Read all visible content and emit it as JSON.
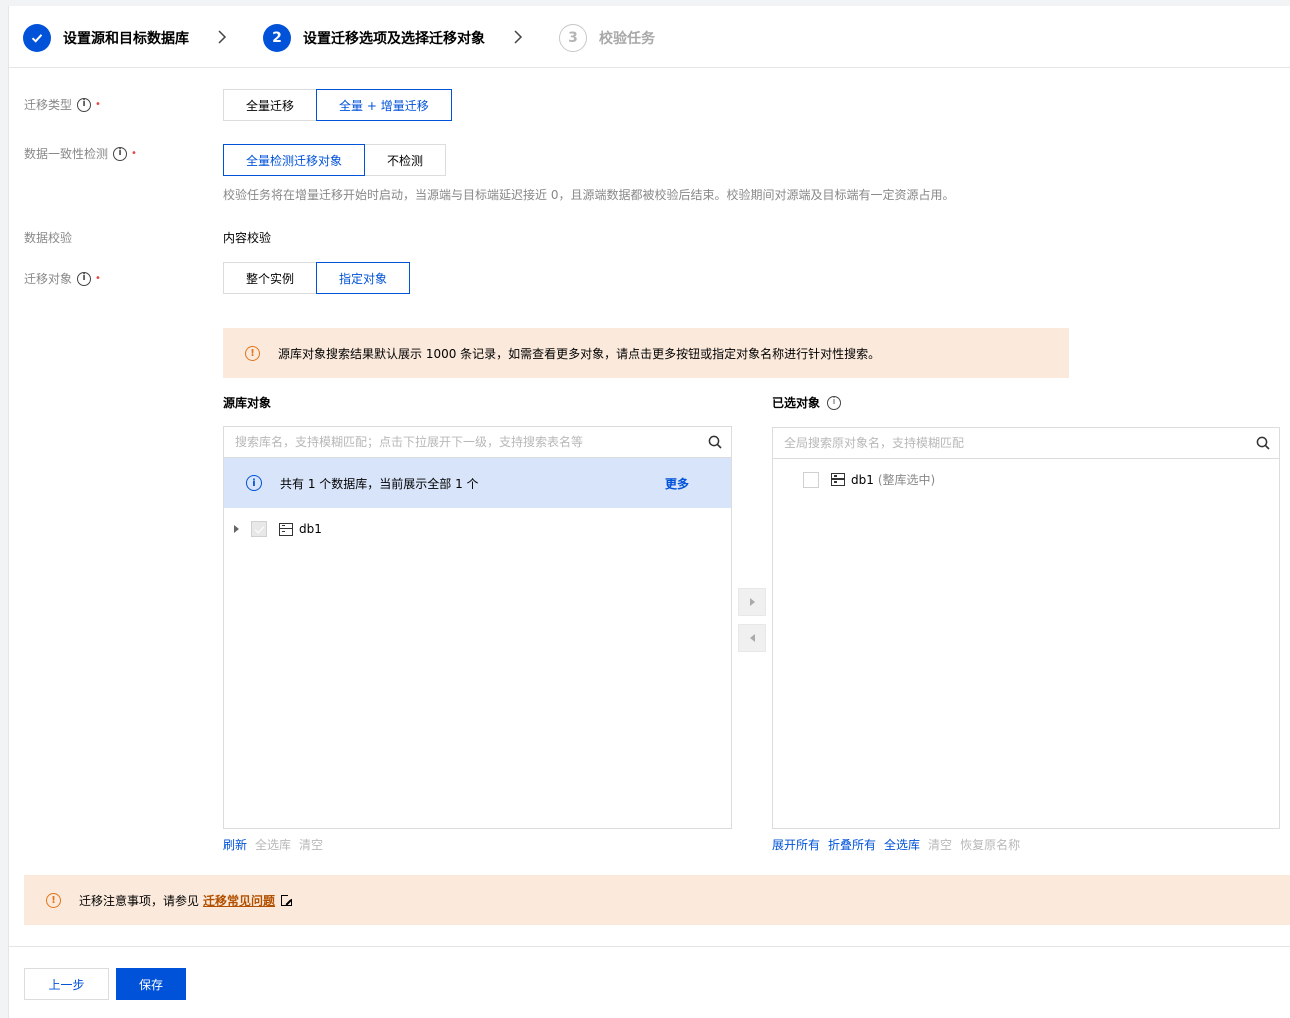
{
  "steps": [
    {
      "number": "",
      "label": "设置源和目标数据库",
      "state": "done"
    },
    {
      "number": "2",
      "label": "设置迁移选项及选择迁移对象",
      "state": "active"
    },
    {
      "number": "3",
      "label": "校验任务",
      "state": "todo"
    }
  ],
  "form": {
    "migration_type": {
      "label": "迁移类型",
      "options": [
        "全量迁移",
        "全量 + 增量迁移"
      ],
      "selected": "全量 + 增量迁移"
    },
    "consistency_check": {
      "label": "数据一致性检测",
      "options": [
        "全量检测迁移对象",
        "不检测"
      ],
      "selected": "全量检测迁移对象",
      "hint": "校验任务将在增量迁移开始时启动，当源端与目标端延迟接近 0，且源端数据都被校验后结束。校验期间对源端及目标端有一定资源占用。"
    },
    "data_verification": {
      "label": "数据校验",
      "value": "内容校验"
    },
    "migration_objects": {
      "label": "迁移对象",
      "options": [
        "整个实例",
        "指定对象"
      ],
      "selected": "指定对象"
    }
  },
  "search_warning": "源库对象搜索结果默认展示 1000 条记录，如需查看更多对象，请点击更多按钮或指定对象名称进行针对性搜索。",
  "source": {
    "title": "源库对象",
    "search_placeholder": "搜索库名，支持模糊匹配；点击下拉展开下一级，支持搜索表名等",
    "info_text": "共有 1 个数据库，当前展示全部 1 个",
    "more_label": "更多",
    "items": [
      {
        "name": "db1"
      }
    ],
    "links": {
      "refresh": "刷新",
      "select_all": "全选库",
      "clear": "清空"
    }
  },
  "selected": {
    "title": "已选对象",
    "search_placeholder": "全局搜索原对象名，支持模糊匹配",
    "items": [
      {
        "name": "db1",
        "note": "(整库选中)"
      }
    ],
    "links": {
      "expand_all": "展开所有",
      "collapse_all": "折叠所有",
      "select_all": "全选库",
      "clear": "清空",
      "restore_names": "恢复原名称"
    }
  },
  "notice": {
    "text": "迁移注意事项，请参见",
    "link": "迁移常见问题"
  },
  "footer": {
    "prev_label": "上一步",
    "save_label": "保存"
  },
  "colors": {
    "primary": "#0052d9",
    "warning_bg": "#fbeadc",
    "warning_icon": "#e37318",
    "info_bg": "#d7e4f9"
  }
}
